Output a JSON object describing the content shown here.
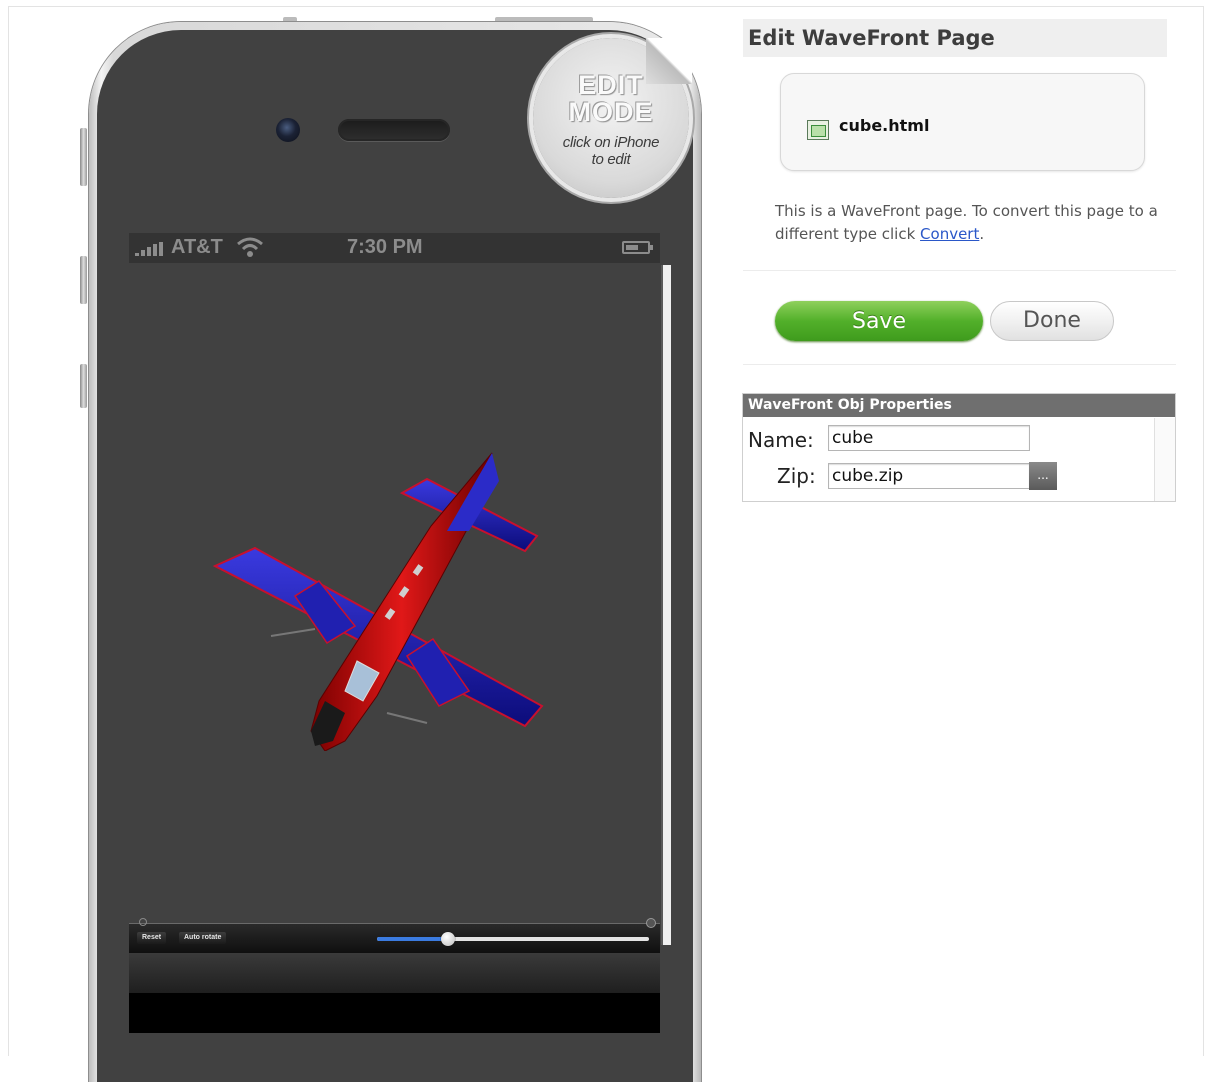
{
  "phone": {
    "badge": {
      "line1": "EDIT",
      "line2": "MODE",
      "hint1": "click on iPhone",
      "hint2": "to edit"
    },
    "status_bar": {
      "carrier": "AT&T",
      "time": "7:30 PM"
    },
    "controls": {
      "reset_label": "Reset",
      "auto_rotate_label": "Auto rotate",
      "slider_fraction": 0.26
    }
  },
  "panel": {
    "title": "Edit WaveFront Page",
    "file_name": "cube.html",
    "description_prefix": "This is a WaveFront page. To convert this page to a different type click ",
    "convert_link": "Convert",
    "description_suffix": ".",
    "save_label": "Save",
    "done_label": "Done"
  },
  "properties": {
    "header": "WaveFront Obj Properties",
    "name_label": "Name:",
    "name_value": "cube",
    "zip_label": "Zip:",
    "zip_value": "cube.zip",
    "browse_label": "..."
  },
  "colors": {
    "save_green": "#52b02a",
    "link_blue": "#2a57c8",
    "header_gray": "#6f6f6f",
    "slider_blue": "#3b7be0"
  }
}
